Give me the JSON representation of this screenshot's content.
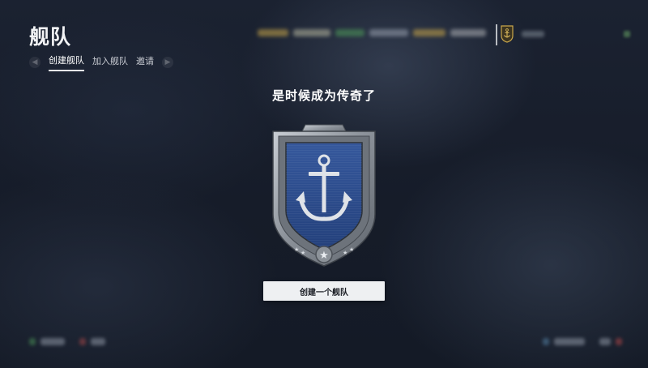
{
  "header": {
    "title": "舰队"
  },
  "tabs": [
    {
      "label": "创建舰队",
      "active": true
    },
    {
      "label": "加入舰队",
      "active": false
    },
    {
      "label": "邀请",
      "active": false
    }
  ],
  "main": {
    "headline": "是时候成为传奇了",
    "create_button_label": "创建一个舰队",
    "emblem_icon": "anchor-icon"
  },
  "colors": {
    "shield_blue": "#2b4a8a",
    "shield_metal": "#9aa0a8",
    "button_bg": "#eef0f2",
    "background": "#171d2a"
  }
}
